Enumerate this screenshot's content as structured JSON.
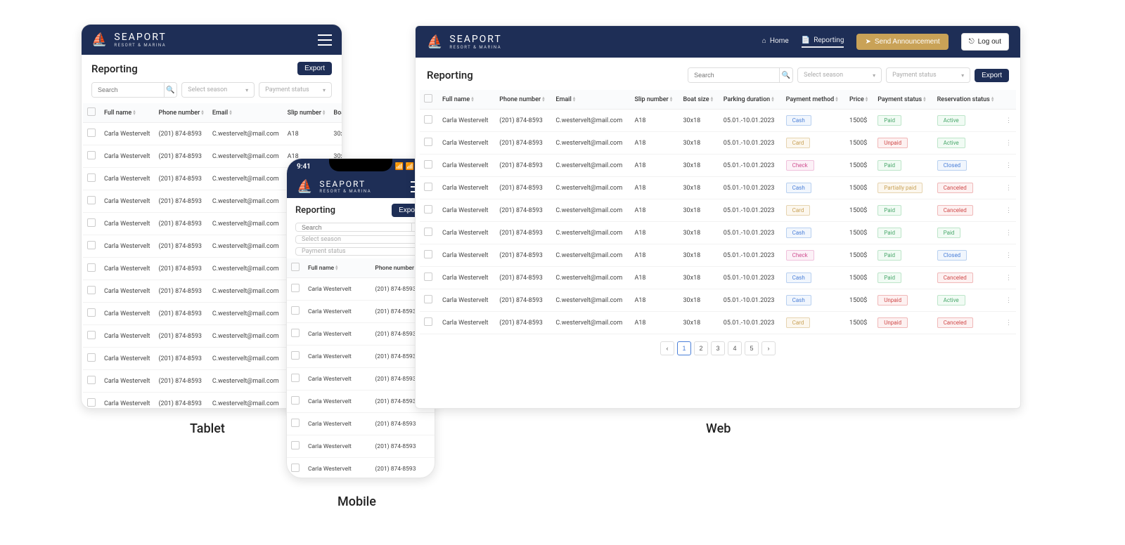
{
  "brand": {
    "name": "SEAPORT",
    "sub": "RESORT & MARINA"
  },
  "page": {
    "title": "Reporting",
    "export": "Export"
  },
  "nav": {
    "home": "Home",
    "reporting": "Reporting",
    "send": "Send Announcement",
    "logout": "Log out"
  },
  "filters": {
    "search": "Search",
    "season": "Select season",
    "status": "Payment status"
  },
  "cols": {
    "name": "Full name",
    "phone": "Phone number",
    "email": "Email",
    "slip": "Slip number",
    "boat": "Boat size",
    "parking": "Parking duration",
    "method": "Payment method",
    "price": "Price",
    "pstatus": "Payment status",
    "rstatus": "Reservation status"
  },
  "common_row": {
    "name": "Carla Westervelt",
    "phone": "(201) 874-8593",
    "email": "C.westervelt@mail.com",
    "slip": "A18",
    "boat": "30x18",
    "parking": "05.01.-10.01.2023",
    "price": "1500$",
    "parking_short": "05.01.-10.0"
  },
  "web_rows": [
    {
      "method": "Cash",
      "mclass": "cash",
      "pstatus": "Paid",
      "pclass": "paid",
      "rstatus": "Active",
      "rclass": "active"
    },
    {
      "method": "Card",
      "mclass": "card",
      "pstatus": "Unpaid",
      "pclass": "unpaid",
      "rstatus": "Active",
      "rclass": "active"
    },
    {
      "method": "Check",
      "mclass": "check",
      "pstatus": "Paid",
      "pclass": "paid",
      "rstatus": "Closed",
      "rclass": "closed"
    },
    {
      "method": "Cash",
      "mclass": "cash",
      "pstatus": "Partially paid",
      "pclass": "partial",
      "rstatus": "Canceled",
      "rclass": "canceled"
    },
    {
      "method": "Card",
      "mclass": "card",
      "pstatus": "Paid",
      "pclass": "paid",
      "rstatus": "Canceled",
      "rclass": "canceled"
    },
    {
      "method": "Cash",
      "mclass": "cash",
      "pstatus": "Paid",
      "pclass": "paid",
      "rstatus": "Paid",
      "rclass": "active"
    },
    {
      "method": "Check",
      "mclass": "check",
      "pstatus": "Paid",
      "pclass": "paid",
      "rstatus": "Closed",
      "rclass": "closed"
    },
    {
      "method": "Cash",
      "mclass": "cash",
      "pstatus": "Paid",
      "pclass": "paid",
      "rstatus": "Canceled",
      "rclass": "canceled"
    },
    {
      "method": "Cash",
      "mclass": "cash",
      "pstatus": "Unpaid",
      "pclass": "unpaid",
      "rstatus": "Active",
      "rclass": "active"
    },
    {
      "method": "Card",
      "mclass": "card",
      "pstatus": "Unpaid",
      "pclass": "unpaid",
      "rstatus": "Canceled",
      "rclass": "canceled"
    }
  ],
  "tablet_row_count": 13,
  "mobile_row_count": 9,
  "pagination": [
    "1",
    "2",
    "3",
    "4",
    "5"
  ],
  "labels": {
    "tablet": "Tablet",
    "mobile": "Mobile",
    "web": "Web"
  },
  "mobile_time": "9:41"
}
